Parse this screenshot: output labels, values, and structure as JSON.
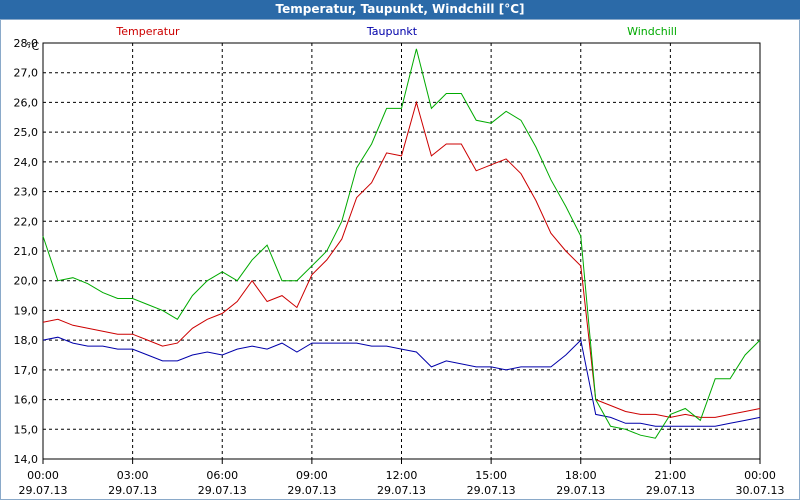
{
  "window": {
    "title": "Temperatur, Taupunkt, Windchill [°C]"
  },
  "chart_data": {
    "type": "line",
    "title": "Temperatur, Taupunkt, Windchill [°C]",
    "ylabel": "°C",
    "ylim": [
      14.0,
      28.0
    ],
    "yticks": [
      "14,0",
      "15,0",
      "16,0",
      "17,0",
      "18,0",
      "19,0",
      "20,0",
      "21,0",
      "22,0",
      "23,0",
      "24,0",
      "25,0",
      "26,0",
      "27,0",
      "28,0"
    ],
    "xlim": [
      0,
      24
    ],
    "xticks": [
      {
        "time": "00:00",
        "date": "29.07.13"
      },
      {
        "time": "03:00",
        "date": "29.07.13"
      },
      {
        "time": "06:00",
        "date": "29.07.13"
      },
      {
        "time": "09:00",
        "date": "29.07.13"
      },
      {
        "time": "12:00",
        "date": "29.07.13"
      },
      {
        "time": "15:00",
        "date": "29.07.13"
      },
      {
        "time": "18:00",
        "date": "29.07.13"
      },
      {
        "time": "21:00",
        "date": "29.07.13"
      },
      {
        "time": "00:00",
        "date": "30.07.13"
      }
    ],
    "grid": true,
    "legend_position": "top",
    "series": [
      {
        "name": "Temperatur",
        "color": "#cc0000",
        "x": [
          0,
          0.5,
          1,
          1.5,
          2,
          2.5,
          3,
          3.5,
          4,
          4.5,
          5,
          5.5,
          6,
          6.5,
          7,
          7.5,
          8,
          8.5,
          9,
          9.5,
          10,
          10.5,
          11,
          11.5,
          12,
          12.5,
          13,
          13.5,
          14,
          14.5,
          15,
          15.5,
          16,
          16.5,
          17,
          17.5,
          18,
          18.5,
          19,
          19.5,
          20,
          20.5,
          21,
          21.5,
          22,
          22.5,
          23,
          23.5,
          24
        ],
        "values": [
          18.6,
          18.7,
          18.5,
          18.4,
          18.3,
          18.2,
          18.2,
          18.0,
          17.8,
          17.9,
          18.4,
          18.7,
          18.9,
          19.3,
          20.0,
          19.3,
          19.5,
          19.1,
          20.2,
          20.7,
          21.4,
          22.8,
          23.3,
          24.3,
          24.2,
          26.0,
          24.2,
          24.6,
          24.6,
          23.7,
          23.9,
          24.1,
          23.6,
          22.7,
          21.6,
          21.0,
          20.5,
          16.0,
          15.8,
          15.6,
          15.5,
          15.5,
          15.4,
          15.5,
          15.4,
          15.4,
          15.5,
          15.6,
          15.7
        ]
      },
      {
        "name": "Taupunkt",
        "color": "#0000aa",
        "x": [
          0,
          0.5,
          1,
          1.5,
          2,
          2.5,
          3,
          3.5,
          4,
          4.5,
          5,
          5.5,
          6,
          6.5,
          7,
          7.5,
          8,
          8.5,
          9,
          9.5,
          10,
          10.5,
          11,
          11.5,
          12,
          12.5,
          13,
          13.5,
          14,
          14.5,
          15,
          15.5,
          16,
          16.5,
          17,
          17.5,
          18,
          18.5,
          19,
          19.5,
          20,
          20.5,
          21,
          21.5,
          22,
          22.5,
          23,
          23.5,
          24
        ],
        "values": [
          18.0,
          18.1,
          17.9,
          17.8,
          17.8,
          17.7,
          17.7,
          17.5,
          17.3,
          17.3,
          17.5,
          17.6,
          17.5,
          17.7,
          17.8,
          17.7,
          17.9,
          17.6,
          17.9,
          17.9,
          17.9,
          17.9,
          17.8,
          17.8,
          17.7,
          17.6,
          17.1,
          17.3,
          17.2,
          17.1,
          17.1,
          17.0,
          17.1,
          17.1,
          17.1,
          17.5,
          18.0,
          15.5,
          15.4,
          15.2,
          15.2,
          15.1,
          15.1,
          15.1,
          15.1,
          15.1,
          15.2,
          15.3,
          15.4
        ]
      },
      {
        "name": "Windchill",
        "color": "#00aa00",
        "x": [
          0,
          0.5,
          1,
          1.5,
          2,
          2.5,
          3,
          3.5,
          4,
          4.5,
          5,
          5.5,
          6,
          6.5,
          7,
          7.5,
          8,
          8.5,
          9,
          9.5,
          10,
          10.5,
          11,
          11.5,
          12,
          12.5,
          13,
          13.5,
          14,
          14.5,
          15,
          15.5,
          16,
          16.5,
          17,
          17.5,
          18,
          18.5,
          19,
          19.5,
          20,
          20.5,
          21,
          21.5,
          22,
          22.5,
          23,
          23.5,
          24
        ],
        "values": [
          21.5,
          20.0,
          20.1,
          19.9,
          19.6,
          19.4,
          19.4,
          19.2,
          19.0,
          18.7,
          19.5,
          20.0,
          20.3,
          20.0,
          20.7,
          21.2,
          20.0,
          20.0,
          20.5,
          21.0,
          22.0,
          23.8,
          24.6,
          25.8,
          25.8,
          27.8,
          25.8,
          26.3,
          26.3,
          25.4,
          25.3,
          25.7,
          25.4,
          24.5,
          23.4,
          22.5,
          21.5,
          16.0,
          15.1,
          15.0,
          14.8,
          14.7,
          15.5,
          15.7,
          15.3,
          16.7,
          16.7,
          17.5,
          18.0
        ]
      }
    ]
  }
}
